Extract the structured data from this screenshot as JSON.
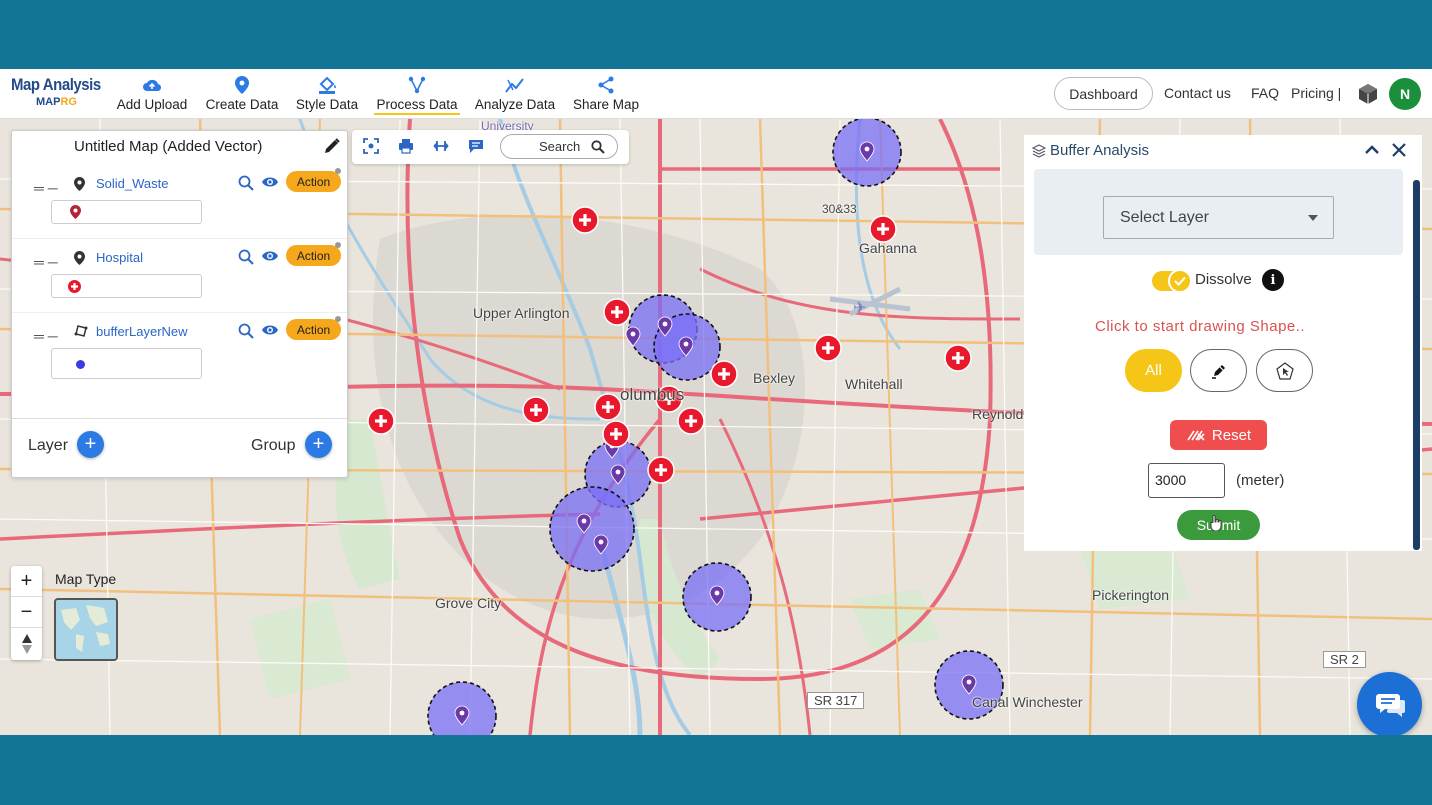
{
  "logo": {
    "title": "Map Analysis",
    "sub_a": "MAP",
    "sub_b": "RG"
  },
  "nav": [
    {
      "label": "Add Upload",
      "icon": "cloud-upload-icon"
    },
    {
      "label": "Create Data",
      "icon": "location-pin-icon"
    },
    {
      "label": "Style Data",
      "icon": "paint-bucket-icon"
    },
    {
      "label": "Process Data",
      "icon": "process-nodes-icon",
      "active": true
    },
    {
      "label": "Analyze Data",
      "icon": "analyze-chart-icon"
    },
    {
      "label": "Share Map",
      "icon": "share-icon"
    }
  ],
  "header_right": {
    "dashboard": "Dashboard",
    "contact": "Contact us",
    "faq": "FAQ",
    "pricing": "Pricing |",
    "avatar_initial": "N"
  },
  "layer_panel": {
    "title": "Untitled Map (Added Vector)",
    "layers": [
      {
        "name": "Solid_Waste",
        "action": "Action",
        "symbol": "pin-icon"
      },
      {
        "name": "Hospital",
        "action": "Action",
        "symbol": "hospital-cross-icon"
      },
      {
        "name": "bufferLayerNew",
        "action": "Action",
        "symbol": "blue-dot-icon"
      }
    ],
    "layer_label": "Layer",
    "group_label": "Group"
  },
  "toolbar": {
    "search_label": "Search"
  },
  "map_type_label": "Map Type",
  "map_labels": [
    "Upper Arlington",
    "Bexley",
    "Whitehall",
    "Gahanna",
    "Grove City",
    "Pickerington",
    "Canal Winchester",
    "Reynold",
    "SR 317",
    "SR 2",
    "olumbus",
    "University",
    "30&33"
  ],
  "buffer_panel": {
    "title": "Buffer Analysis",
    "select_placeholder": "Select Layer",
    "dissolve_label": "Dissolve",
    "dissolve_on": true,
    "hint": "Click to start drawing Shape..",
    "all_label": "All",
    "reset_label": "Reset",
    "distance_value": "3000",
    "unit_label": "(meter)",
    "submit_label": "Submit"
  },
  "colors": {
    "outer_background": "#127595",
    "buffer_fill": "#7a6ff5",
    "hospital_marker": "#e8192c",
    "action": "#f5a81c",
    "accent_yellow": "#f5c518",
    "reset": "#f04e4e",
    "submit": "#3b9a3b"
  }
}
